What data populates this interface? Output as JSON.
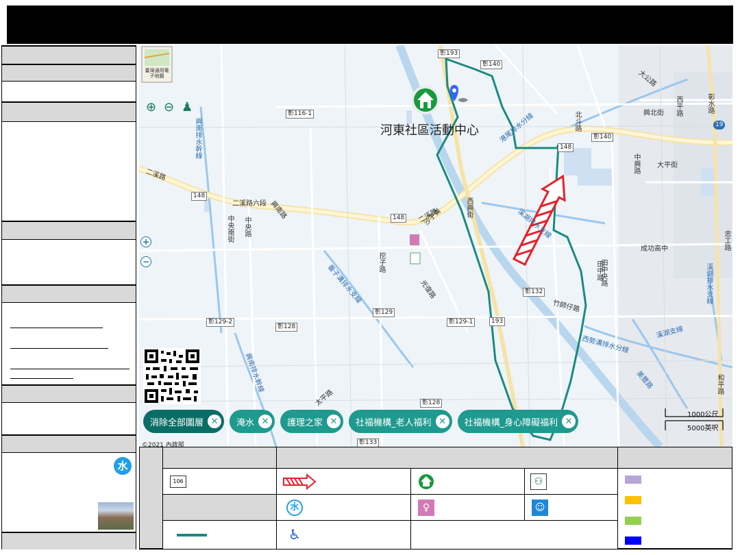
{
  "map": {
    "basemap_button_label": "臺灣通用電子地圖",
    "site_label": "河東社區活動中心",
    "roads": [
      "二溪路",
      "二溪路六段",
      "中央南街",
      "興南路",
      "中央路",
      "沙子崙",
      "挖子路",
      "光復路",
      "西興街",
      "田中央路",
      "竹師仔路",
      "太平路",
      "北斗路",
      "和平路",
      "大公路",
      "西平路",
      "華中街",
      "大平街",
      "彰水路",
      "田尾路",
      "興北街",
      "中興路",
      "彰水路三段",
      "大北街",
      "頂興路",
      "太公路",
      "民生路",
      "彰水路",
      "忠工路",
      "功成路",
      "成功高中",
      "田中路"
    ],
    "waterways": [
      "興南排水幹線",
      "溪湖排水支線",
      "舊濁水溪",
      "西勢湖排水分線",
      "溪湖排水支線",
      "港尾排水分線",
      "番子溝排水支線",
      "西勢溝排水分線",
      "溪湖支線",
      "美豐路"
    ],
    "route_shields": [
      "彰193",
      "彰140",
      "彰116-1",
      "148",
      "148",
      "彰140",
      "148",
      "彰132",
      "彰129",
      "彰128",
      "彰129-2",
      "彰129-1",
      "193",
      "彰128",
      "彰133",
      "19"
    ],
    "scale_bar": {
      "label_1": "1000公尺",
      "label_2": "5000英呎"
    },
    "layer_chips": [
      {
        "label": "消除全部圖層",
        "dark": true
      },
      {
        "label": "淹水",
        "dark": false
      },
      {
        "label": "護理之家",
        "dark": false
      },
      {
        "label": "社福機構_老人福利",
        "dark": false
      },
      {
        "label": "社福機構_身心障礙福利",
        "dark": false
      }
    ],
    "copyright": "©2021 內政部"
  },
  "legend": {
    "shield_sample": "106",
    "icons": [
      "route-shield",
      "evacuation-arrow",
      "shelter-house",
      "childcare",
      "flood-water",
      "women-welfare",
      "infant-care",
      "accessible",
      "boundary-line"
    ],
    "colors": {
      "teal": "#1a8a80",
      "red": "#e8202a",
      "lavender": "#b4a7d6",
      "orange": "#ffc000",
      "green": "#92d050",
      "blue": "#0000ff"
    }
  },
  "left_panel": {
    "water_icon": "水"
  }
}
